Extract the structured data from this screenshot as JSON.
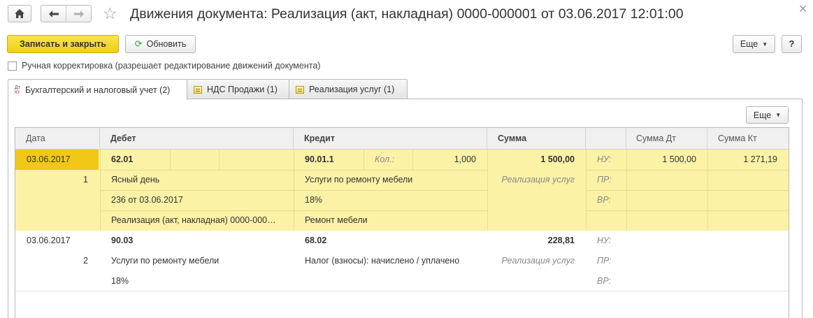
{
  "window": {
    "title": "Движения документа: Реализация (акт, накладная) 0000-000001 от 03.06.2017 12:01:00"
  },
  "toolbar": {
    "save_close": "Записать и закрыть",
    "refresh": "Обновить",
    "more": "Еще",
    "help": "?"
  },
  "manual_correction": {
    "label": "Ручная корректировка (разрешает редактирование движений документа)",
    "checked": false
  },
  "tabs": [
    {
      "label": "Бухгалтерский и налоговый учет (2)",
      "icon": "dt-kt-icon",
      "icon_text": [
        "Дт",
        "Кт"
      ],
      "active": true
    },
    {
      "label": "НДС Продажи (1)",
      "icon": "register-icon",
      "active": false
    },
    {
      "label": "Реализация услуг (1)",
      "icon": "register-icon",
      "active": false
    }
  ],
  "grid": {
    "more": "Еще",
    "columns": [
      "Дата",
      "Дебет",
      "Кредит",
      "Сумма",
      "",
      "Сумма Дт",
      "Сумма Кт"
    ],
    "entries": [
      {
        "date": "03.06.2017",
        "number": "1",
        "debit_account": "62.01",
        "debit_sub": [
          "Ясный день",
          "236 от 03.06.2017",
          "Реализация (акт, накладная) 0000-000…"
        ],
        "credit_account": "90.01.1",
        "credit_qty_label": "Кол.:",
        "credit_qty": "1,000",
        "credit_sub": [
          "Услуги по ремонту мебели",
          "18%",
          "Ремонт мебели"
        ],
        "sum": "1 500,00",
        "content": "Реализация услуг",
        "flags": [
          "НУ:",
          "ПР:",
          "ВР:"
        ],
        "sum_dt": "1 500,00",
        "sum_kt": "1 271,19"
      },
      {
        "date": "03.06.2017",
        "number": "2",
        "debit_account": "90.03",
        "debit_sub": [
          "Услуги по ремонту мебели",
          "18%"
        ],
        "credit_account": "68.02",
        "credit_sub": [
          "Налог (взносы): начислено / уплачено"
        ],
        "sum": "228,81",
        "content": "Реализация услуг",
        "flags": [
          "НУ:",
          "ПР:",
          "ВР:"
        ]
      }
    ]
  }
}
